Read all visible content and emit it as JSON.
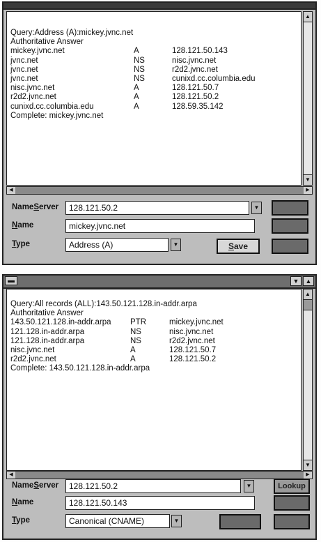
{
  "win1": {
    "query": "Query:Address (A):mickey.jvnc.net",
    "authoritative": "Authoritative Answer",
    "records": [
      {
        "name": "mickey.jvnc.net",
        "type": "A",
        "data": "128.121.50.143"
      },
      {
        "name": "jvnc.net",
        "type": "NS",
        "data": "nisc.jvnc.net"
      },
      {
        "name": "jvnc.net",
        "type": "NS",
        "data": "r2d2.jvnc.net"
      },
      {
        "name": "jvnc.net",
        "type": "NS",
        "data": "cunixd.cc.columbia.edu"
      },
      {
        "name": "nisc.jvnc.net",
        "type": "A",
        "data": "128.121.50.7"
      },
      {
        "name": "r2d2.jvnc.net",
        "type": "A",
        "data": "128.121.50.2"
      },
      {
        "name": "cunixd.cc.columbia.edu",
        "type": "A",
        "data": "128.59.35.142"
      }
    ],
    "complete": "Complete: mickey.jvnc.net",
    "nameserver_label_pre": "Name",
    "nameserver_label_u": "S",
    "nameserver_label_post": "erver",
    "nameserver_value": "128.121.50.2",
    "name_label_u": "N",
    "name_label_post": "ame",
    "name_value": "mickey.jvnc.net",
    "type_label_u": "T",
    "type_label_post": "ype",
    "type_value": "Address (A)",
    "save_label_u": "S",
    "save_label_post": "ave"
  },
  "win2": {
    "query": "Query:All records (ALL):143.50.121.128.in-addr.arpa",
    "authoritative": "Authoritative Answer",
    "records": [
      {
        "name": "143.50.121.128.in-addr.arpa",
        "type": "PTR",
        "data": "mickey.jvnc.net"
      },
      {
        "name": "121.128.in-addr.arpa",
        "type": "NS",
        "data": "nisc.jvnc.net"
      },
      {
        "name": "121.128.in-addr.arpa",
        "type": "NS",
        "data": "r2d2.jvnc.net"
      },
      {
        "name": "nisc.jvnc.net",
        "type": "A",
        "data": "128.121.50.7"
      },
      {
        "name": "r2d2.jvnc.net",
        "type": "A",
        "data": "128.121.50.2"
      }
    ],
    "complete": "Complete: 143.50.121.128.in-addr.arpa",
    "nameserver_label_pre": "Name",
    "nameserver_label_u": "S",
    "nameserver_label_post": "erver",
    "nameserver_value": "128.121.50.2",
    "name_label_u": "N",
    "name_label_post": "ame",
    "name_value": "128.121.50.143",
    "type_label_u": "T",
    "type_label_post": "ype",
    "type_value": "Canonical (CNAME)",
    "lookup_label": "Lookup"
  },
  "icons": {
    "sysmenu": "system-menu-icon",
    "minimize": "minimize-icon",
    "maximize": "maximize-icon",
    "dropdown": "chevron-down-icon"
  }
}
